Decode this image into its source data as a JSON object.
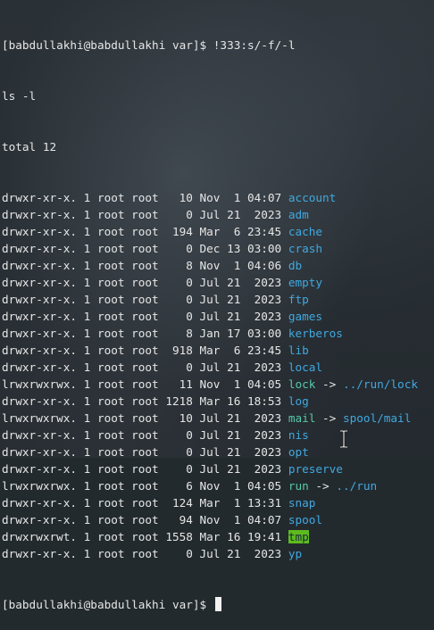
{
  "prompt": "[babdullakhi@babdullakhi var]$ ",
  "command": "!333:s/-f/-l",
  "echo": "ls -l",
  "total": "total 12",
  "entries": [
    {
      "meta": "drwxr-xr-x. 1 root root   10 Nov  1 04:07 ",
      "name": "account",
      "kind": "dir",
      "target": ""
    },
    {
      "meta": "drwxr-xr-x. 1 root root    0 Jul 21  2023 ",
      "name": "adm",
      "kind": "dir",
      "target": ""
    },
    {
      "meta": "drwxr-xr-x. 1 root root  194 Mar  6 23:45 ",
      "name": "cache",
      "kind": "dir",
      "target": ""
    },
    {
      "meta": "drwxr-xr-x. 1 root root    0 Dec 13 03:00 ",
      "name": "crash",
      "kind": "dir",
      "target": ""
    },
    {
      "meta": "drwxr-xr-x. 1 root root    8 Nov  1 04:06 ",
      "name": "db",
      "kind": "dir",
      "target": ""
    },
    {
      "meta": "drwxr-xr-x. 1 root root    0 Jul 21  2023 ",
      "name": "empty",
      "kind": "dir",
      "target": ""
    },
    {
      "meta": "drwxr-xr-x. 1 root root    0 Jul 21  2023 ",
      "name": "ftp",
      "kind": "dir",
      "target": ""
    },
    {
      "meta": "drwxr-xr-x. 1 root root    0 Jul 21  2023 ",
      "name": "games",
      "kind": "dir",
      "target": ""
    },
    {
      "meta": "drwxr-xr-x. 1 root root    8 Jan 17 03:00 ",
      "name": "kerberos",
      "kind": "dir",
      "target": ""
    },
    {
      "meta": "drwxr-xr-x. 1 root root  918 Mar  6 23:45 ",
      "name": "lib",
      "kind": "dir",
      "target": ""
    },
    {
      "meta": "drwxr-xr-x. 1 root root    0 Jul 21  2023 ",
      "name": "local",
      "kind": "dir",
      "target": ""
    },
    {
      "meta": "lrwxrwxrwx. 1 root root   11 Nov  1 04:05 ",
      "name": "lock",
      "kind": "link",
      "target": "../run/lock"
    },
    {
      "meta": "drwxr-xr-x. 1 root root 1218 Mar 16 18:53 ",
      "name": "log",
      "kind": "dir",
      "target": ""
    },
    {
      "meta": "lrwxrwxrwx. 1 root root   10 Jul 21  2023 ",
      "name": "mail",
      "kind": "link",
      "target": "spool/mail"
    },
    {
      "meta": "drwxr-xr-x. 1 root root    0 Jul 21  2023 ",
      "name": "nis",
      "kind": "dir",
      "target": ""
    },
    {
      "meta": "drwxr-xr-x. 1 root root    0 Jul 21  2023 ",
      "name": "opt",
      "kind": "dir",
      "target": ""
    },
    {
      "meta": "drwxr-xr-x. 1 root root    0 Jul 21  2023 ",
      "name": "preserve",
      "kind": "dir",
      "target": ""
    },
    {
      "meta": "lrwxrwxrwx. 1 root root    6 Nov  1 04:05 ",
      "name": "run",
      "kind": "link",
      "target": "../run"
    },
    {
      "meta": "drwxr-xr-x. 1 root root  124 Mar  1 13:31 ",
      "name": "snap",
      "kind": "dir",
      "target": ""
    },
    {
      "meta": "drwxr-xr-x. 1 root root   94 Nov  1 04:07 ",
      "name": "spool",
      "kind": "dir",
      "target": ""
    },
    {
      "meta": "drwxrwxrwt. 1 root root 1558 Mar 16 19:41 ",
      "name": "tmp",
      "kind": "sticky",
      "target": ""
    },
    {
      "meta": "drwxr-xr-x. 1 root root    0 Jul 21  2023 ",
      "name": "yp",
      "kind": "dir",
      "target": ""
    }
  ],
  "arrow": " -> ",
  "colors": {
    "background": "#232a2e",
    "text": "#e6e6e6",
    "directory": "#41a8e0",
    "symlink": "#57c9a8",
    "sticky_bg": "#5dbb1e"
  },
  "icons": {
    "cursor": "block-cursor-icon",
    "mouse": "i-beam-cursor-icon"
  }
}
